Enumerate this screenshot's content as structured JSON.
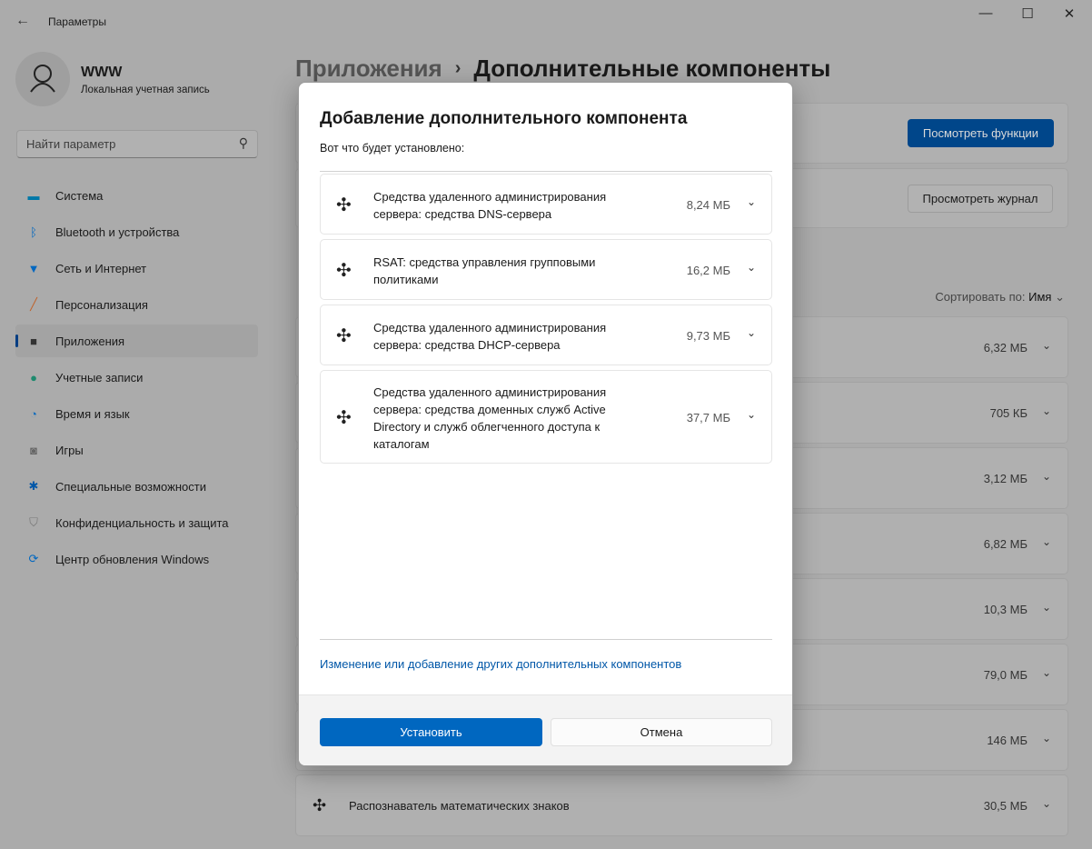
{
  "window": {
    "title": "Параметры"
  },
  "user": {
    "name": "WWW",
    "account_type": "Локальная учетная запись"
  },
  "search": {
    "placeholder": "Найти параметр"
  },
  "sidebar": {
    "items": [
      {
        "label": "Система",
        "icon": "system-icon",
        "color": "#0078a8"
      },
      {
        "label": "Bluetooth и устройства",
        "icon": "bluetooth-icon",
        "color": "#0067c0"
      },
      {
        "label": "Сеть и Интернет",
        "icon": "wifi-icon",
        "color": "#0067c0"
      },
      {
        "label": "Персонализация",
        "icon": "brush-icon",
        "color": "#c0622a"
      },
      {
        "label": "Приложения",
        "icon": "apps-icon",
        "color": "#333333",
        "selected": true
      },
      {
        "label": "Учетные записи",
        "icon": "person-icon",
        "color": "#1e8a6e"
      },
      {
        "label": "Время и язык",
        "icon": "clock-globe-icon",
        "color": "#0f6cbd"
      },
      {
        "label": "Игры",
        "icon": "gamepad-icon",
        "color": "#666666"
      },
      {
        "label": "Специальные возможности",
        "icon": "accessibility-icon",
        "color": "#0057a8"
      },
      {
        "label": "Конфиденциальность и защита",
        "icon": "shield-icon",
        "color": "#777777"
      },
      {
        "label": "Центр обновления Windows",
        "icon": "update-icon",
        "color": "#0067c0"
      }
    ]
  },
  "header": {
    "parent": "Приложения",
    "title": "Дополнительные компоненты"
  },
  "main": {
    "view_features_button": "Посмотреть функции",
    "view_history_button": "Просмотреть журнал",
    "sort_label": "Сортировать по:",
    "sort_value": "Имя",
    "rows": [
      {
        "name": "",
        "size": "6,32 МБ"
      },
      {
        "name": "",
        "size": "705 КБ"
      },
      {
        "name": "",
        "size": "3,12 МБ"
      },
      {
        "name": "",
        "size": "6,82 МБ"
      },
      {
        "name": "",
        "size": "10,3 МБ"
      },
      {
        "name": "",
        "size": "79,0 МБ"
      },
      {
        "name": "",
        "size": "146 МБ"
      },
      {
        "name": "Распознаватель математических знаков",
        "size": "30,5 МБ"
      }
    ]
  },
  "dialog": {
    "title": "Добавление дополнительного компонента",
    "subtitle": "Вот что будет установлено:",
    "items": [
      {
        "name": "Средства удаленного администрирования сервера: средства DNS-сервера",
        "size": "8,24 МБ"
      },
      {
        "name": "RSAT: средства управления групповыми политиками",
        "size": "16,2 МБ"
      },
      {
        "name": "Средства удаленного администрирования сервера: средства DHCP-сервера",
        "size": "9,73 МБ"
      },
      {
        "name": "Средства удаленного администрирования сервера: средства доменных служб Active Directory и служб облегченного доступа к каталогам",
        "size": "37,7 МБ"
      }
    ],
    "link": "Изменение или добавление других дополнительных компонентов",
    "install_button": "Установить",
    "cancel_button": "Отмена"
  }
}
